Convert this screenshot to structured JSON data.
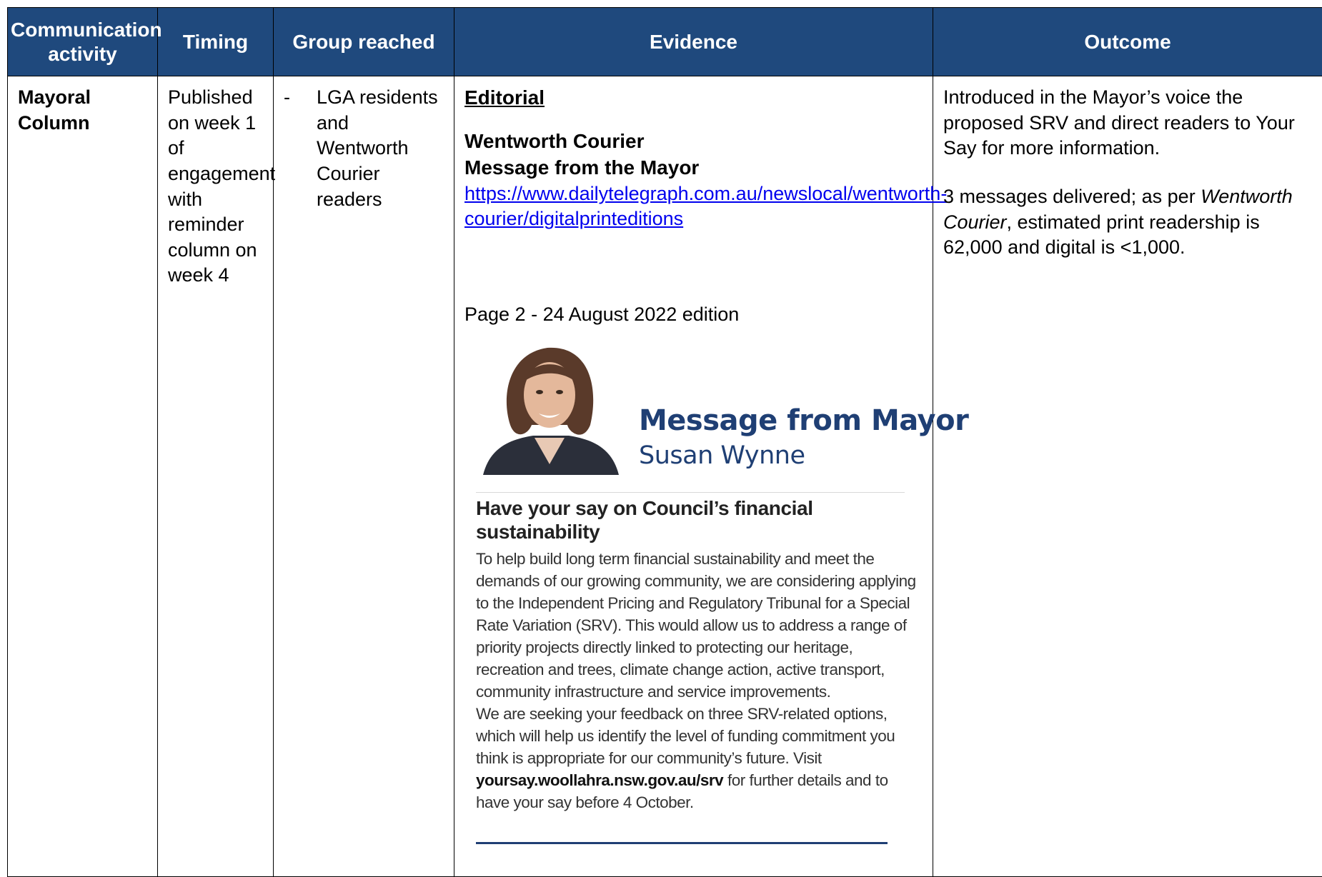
{
  "headers": {
    "activity": "Communication activity",
    "timing": "Timing",
    "group": "Group reached",
    "evidence": "Evidence",
    "outcome": "Outcome"
  },
  "row": {
    "activity": "Mayoral Column",
    "timing": "Published on week 1 of engagement with reminder column on week 4",
    "group_bullet": "-",
    "group": "LGA residents and Wentworth Courier readers",
    "evidence": {
      "section_title": "Editorial",
      "publication": "Wentworth Courier",
      "subtitle": "Message from the Mayor",
      "link": "https://www.dailytelegraph.com.au/newslocal/wentworth-courier/digitalprinteditions",
      "page_ref": "Page 2 - 24 August 2022 edition",
      "clipping": {
        "title": "Message from Mayor",
        "mayor_name": "Susan Wynne",
        "headline": "Have your say on Council’s financial sustainability",
        "para1": "To help build long term financial sustainability and meet the demands of our growing community, we are considering applying to the Independent Pricing and Regulatory Tribunal for a Special Rate Variation (SRV). This would allow us to address a range of priority projects directly linked to protecting our heritage, recreation and trees, climate change action, active transport, community infrastructure and service improvements.",
        "para2_start": "We are seeking your feedback on three SRV-related options, which will help us identify the level of funding commitment you think is appropriate for our community’s future. Visit ",
        "para2_url": "yoursay.woollahra.nsw.gov.au/srv",
        "para2_end": " for further details and to have your say before 4 October."
      }
    },
    "outcome": {
      "para1": "Introduced in the Mayor’s voice the proposed SRV and direct readers to Your Say for more information.",
      "para2_a": "3 messages delivered; as per ",
      "para2_italic": "Wentworth Courier",
      "para2_b": ", estimated print readership is 62,000 and digital is <1,000."
    }
  },
  "colors": {
    "header_bg": "#1f497d",
    "header_text": "#ffffff",
    "link": "#0000ee",
    "clip_blue": "#1f3f74"
  }
}
